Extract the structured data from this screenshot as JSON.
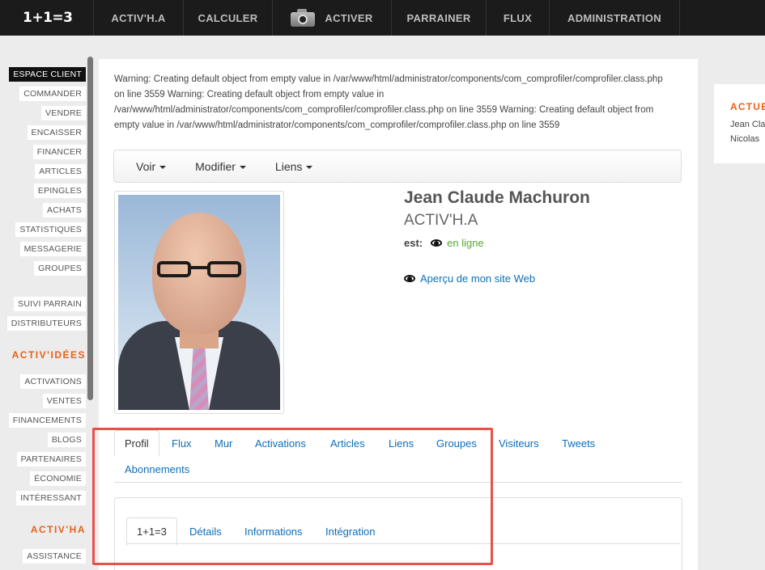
{
  "topbar": {
    "brand": "1+1=3",
    "items": [
      "ACTIV'H.A",
      "CALCULER",
      "ACTIVER",
      "PARRAINER",
      "FLUX",
      "ADMINISTRATION"
    ]
  },
  "sidebar": {
    "items": [
      "ESPACE CLIENT",
      "COMMANDER",
      "VENDRE",
      "ENCAISSER",
      "FINANCER",
      "ARTICLES",
      "EPINGLES",
      "ACHATS",
      "STATISTIQUES",
      "MESSAGERIE",
      "GROUPES"
    ],
    "items2": [
      "SUIVI PARRAIN",
      "DISTRIBUTEURS"
    ],
    "heading_ideas": "ACTIV'IDÉES",
    "items3": [
      "ACTIVATIONS",
      "VENTES",
      "FINANCEMENTS",
      "BLOGS",
      "PARTENAIRES",
      "ÉCONOMIE",
      "INTÉRESSANT"
    ],
    "heading_ha": "ACTIV'HA",
    "items4": [
      "ASSISTANCE"
    ]
  },
  "warning": "Warning: Creating default object from empty value in /var/www/html/administrator/components/com_comprofiler/comprofiler.class.php on line 3559 Warning: Creating default object from empty value in /var/www/html/administrator/components/com_comprofiler/comprofiler.class.php on line 3559 Warning: Creating default object from empty value in /var/www/html/administrator/components/com_comprofiler/comprofiler.class.php on line 3559",
  "toolbar": {
    "voir": "Voir",
    "modifier": "Modifier",
    "liens": "Liens"
  },
  "profile": {
    "name": "Jean Claude Machuron",
    "org": "ACTIV'H.A",
    "status_label": "est:",
    "status_value": "en ligne",
    "website": "Aperçu de mon site Web"
  },
  "tabs": [
    "Profil",
    "Flux",
    "Mur",
    "Activations",
    "Articles",
    "Liens",
    "Groupes",
    "Visiteurs",
    "Tweets",
    "Abonnements"
  ],
  "subtabs": [
    "1+1=3",
    "Détails",
    "Informations",
    "Intégration"
  ],
  "right": {
    "heading": "ACTUE",
    "lines": [
      "Jean Cla",
      "Nicolas"
    ]
  },
  "colors": {
    "accent": "#e8611a",
    "link": "#0d6fb8",
    "online": "#56a832",
    "highlight": "#e8504a"
  }
}
